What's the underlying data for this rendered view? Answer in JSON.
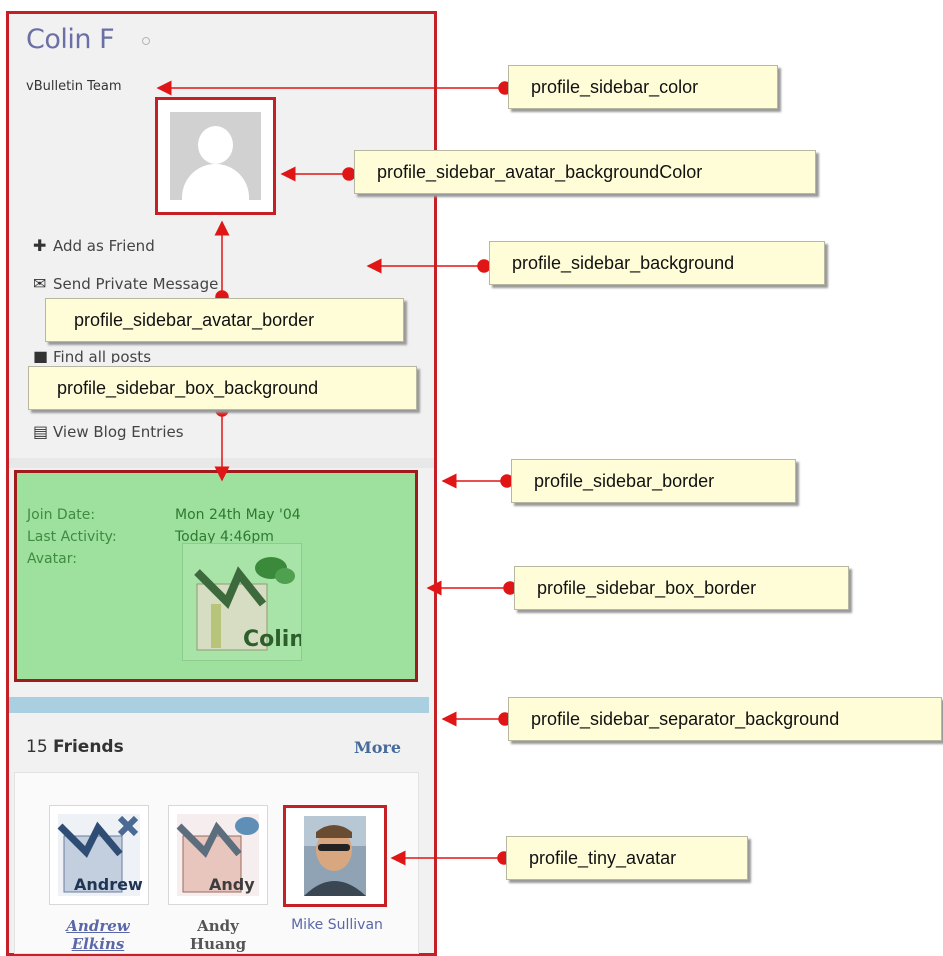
{
  "profile": {
    "username": "Colin F",
    "usertitle": "vBulletin Team",
    "actions": [
      {
        "icon": "plus-icon",
        "label": "Add as Friend"
      },
      {
        "icon": "envelope-icon",
        "label": "Send Private Message"
      },
      {
        "icon": "posts-icon",
        "label": "Find all posts"
      },
      {
        "icon": "blog-icon",
        "label": "View Blog Entries"
      }
    ]
  },
  "info_box": {
    "join_label": "Join Date:",
    "join_value": "Mon 24th May '04",
    "activity_label": "Last Activity:",
    "activity_value": "Today 4:46pm",
    "avatar_label": "Avatar:",
    "avatar_text": "Colin"
  },
  "friends": {
    "count": "15",
    "label": "Friends",
    "more": "More",
    "items": [
      {
        "name_line1": "Andrew",
        "name_line2": "Elkins",
        "avatar_text": "Andrew"
      },
      {
        "name_line1": "Andy",
        "name_line2": "Huang",
        "avatar_text": "Andy"
      },
      {
        "name_line1": "Mike Sullivan",
        "name_line2": ""
      }
    ]
  },
  "callouts": {
    "sidebar_color": "profile_sidebar_color",
    "avatar_bg": "profile_sidebar_avatar_backgroundColor",
    "sidebar_bg": "profile_sidebar_background",
    "avatar_border": "profile_sidebar_avatar_border",
    "box_bg": "profile_sidebar_box_background",
    "sidebar_border": "profile_sidebar_border",
    "box_border": "profile_sidebar_box_border",
    "separator_bg": "profile_sidebar_separator_background",
    "tiny_avatar": "profile_tiny_avatar"
  },
  "colors": {
    "annotation_red": "#e01616",
    "sidebar_border": "#c42026",
    "box_bg": "#9ee09e",
    "separator": "#a9cfe1",
    "callout_bg": "#fffdd8"
  }
}
